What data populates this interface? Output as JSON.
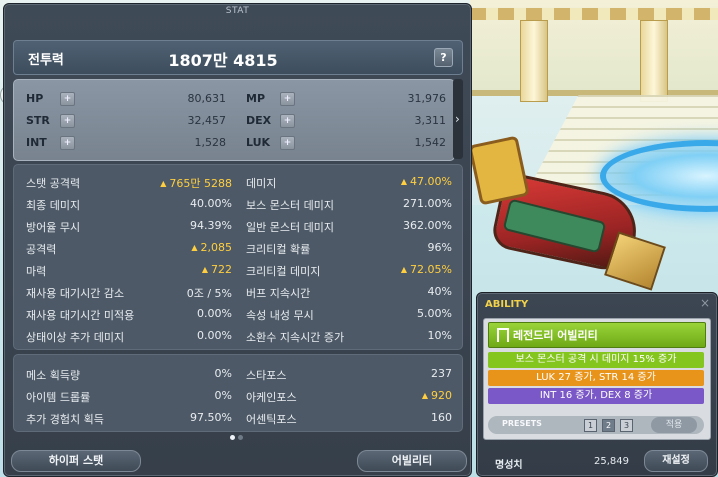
{
  "stat_window": {
    "title": "STAT",
    "combat_power": {
      "label": "전투력",
      "value": "1807만 4815",
      "help": "?"
    },
    "main_stats": [
      {
        "label": "HP",
        "value": "80,631",
        "plus": "+"
      },
      {
        "label": "MP",
        "value": "31,976",
        "plus": "+"
      },
      {
        "label": "STR",
        "value": "32,457",
        "plus": "+"
      },
      {
        "label": "DEX",
        "value": "3,311",
        "plus": "+"
      },
      {
        "label": "INT",
        "value": "1,528",
        "plus": "+"
      },
      {
        "label": "LUK",
        "value": "1,542",
        "plus": "+"
      }
    ],
    "scroll_arrow": "›",
    "detail_stats": [
      {
        "label": "스탯 공격력",
        "value": "765만 5288",
        "up": true
      },
      {
        "label": "데미지",
        "value": "47.00%",
        "up": true
      },
      {
        "label": "최종 데미지",
        "value": "40.00%",
        "up": false
      },
      {
        "label": "보스 몬스터 데미지",
        "value": "271.00%",
        "up": false
      },
      {
        "label": "방어율 무시",
        "value": "94.39%",
        "up": false
      },
      {
        "label": "일반 몬스터 데미지",
        "value": "362.00%",
        "up": false
      },
      {
        "label": "공격력",
        "value": "2,085",
        "up": true
      },
      {
        "label": "크리티컬 확률",
        "value": "96%",
        "up": false
      },
      {
        "label": "마력",
        "value": "722",
        "up": true
      },
      {
        "label": "크리티컬 데미지",
        "value": "72.05%",
        "up": true
      },
      {
        "label": "재사용 대기시간 감소",
        "value": "0조 / 5%",
        "up": false
      },
      {
        "label": "버프 지속시간",
        "value": "40%",
        "up": false
      },
      {
        "label": "재사용 대기시간 미적용",
        "value": "0.00%",
        "up": false
      },
      {
        "label": "속성 내성 무시",
        "value": "5.00%",
        "up": false
      },
      {
        "label": "상태이상 추가 데미지",
        "value": "0.00%",
        "up": false
      },
      {
        "label": "소환수 지속시간 증가",
        "value": "10%",
        "up": false
      }
    ],
    "etc_stats": [
      {
        "label": "메소 획득량",
        "value": "0%",
        "up": false
      },
      {
        "label": "스타포스",
        "value": "237",
        "up": false
      },
      {
        "label": "아이템 드롭률",
        "value": "0%",
        "up": false
      },
      {
        "label": "아케인포스",
        "value": "920",
        "up": true
      },
      {
        "label": "추가 경험치 획득",
        "value": "97.50%",
        "up": false
      },
      {
        "label": "어센틱포스",
        "value": "160",
        "up": false
      }
    ],
    "up_arrow": "▲",
    "page_dots": {
      "total": 2,
      "active": 0
    },
    "hyper_stat_button": "하이퍼 스탯",
    "ability_button": "어빌리티"
  },
  "ability_window": {
    "title": "ABILITY",
    "close": "×",
    "grade": "레전드리 어빌리티",
    "lines": [
      "보스 몬스터 공격 시 데미지 15% 증가",
      "LUK 27 증가, STR 14 증가",
      "INT 16 증가, DEX 8 증가"
    ],
    "presets_label": "PRESETS",
    "presets": [
      "1",
      "2",
      "3"
    ],
    "active_preset": 1,
    "apply_button": "적용",
    "fame_label": "명성치",
    "fame_value": "25,849",
    "reset_button": "재설정"
  }
}
